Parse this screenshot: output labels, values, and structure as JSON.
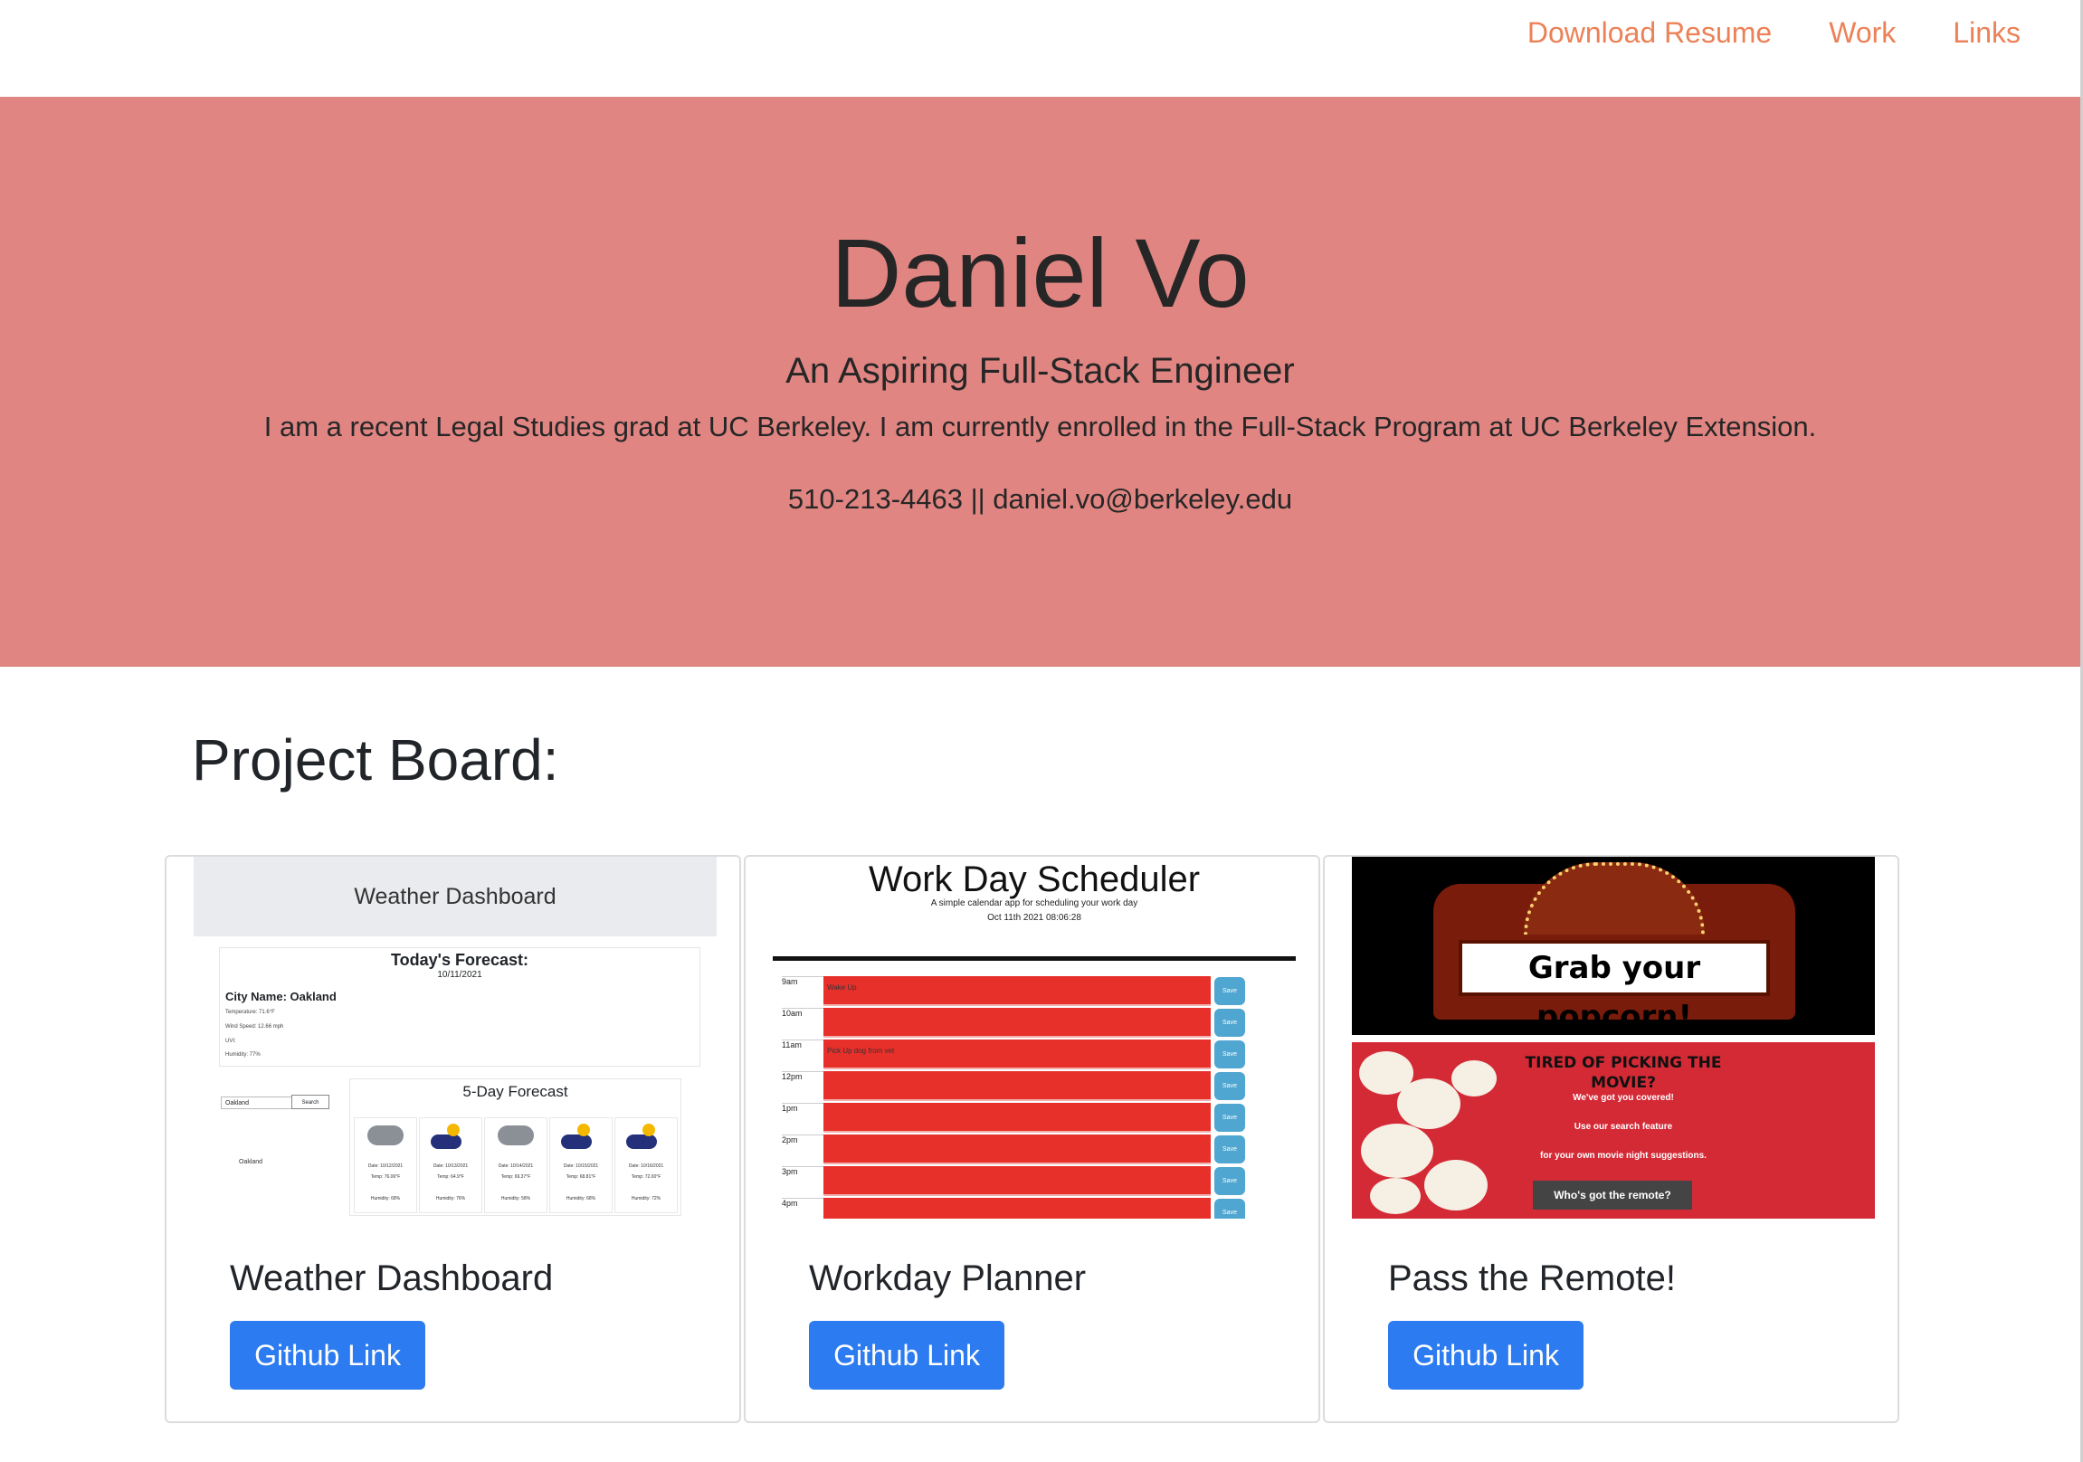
{
  "nav": {
    "links": [
      "Download Resume",
      "Work",
      "Links"
    ]
  },
  "hero": {
    "name": "Daniel Vo",
    "subtitle": "An Aspiring Full-Stack Engineer",
    "bio": "I am a recent Legal Studies grad at UC Berkeley. I am currently enrolled in the Full-Stack Program at UC Berkeley Extension.",
    "contact": "510-213-4463 || daniel.vo@berkeley.edu"
  },
  "board": {
    "title": "Project Board:"
  },
  "projects": [
    {
      "title": "Weather Dashboard",
      "button": "Github Link",
      "screenshot": {
        "header": "Weather Dashboard",
        "today_title": "Today's Forecast:",
        "today_date": "10/11/2021",
        "city": "City Name: Oakland",
        "temperature": "Temperature: 71.6°F",
        "wind": "Wind Speed: 12.66 mph",
        "uvi": "UVI:",
        "humidity": "Humidity: 77%",
        "search_value": "Oakland",
        "search_button": "Search",
        "history_item": "Oakland",
        "five_day_title": "5-Day Forecast",
        "days": [
          {
            "date": "Date: 10/12/2021",
            "temp": "Temp: 76.06°F",
            "humidity": "Humidity: 68%",
            "icon": "cloud-icon"
          },
          {
            "date": "Date: 10/13/2021",
            "temp": "Temp: 64.9°F",
            "humidity": "Humidity: 76%",
            "icon": "rain-sun-icon"
          },
          {
            "date": "Date: 10/14/2021",
            "temp": "Temp: 69.37°F",
            "humidity": "Humidity: 58%",
            "icon": "cloud-icon"
          },
          {
            "date": "Date: 10/15/2021",
            "temp": "Temp: 68.81°F",
            "humidity": "Humidity: 68%",
            "icon": "rain-sun-icon"
          },
          {
            "date": "Date: 10/16/2021",
            "temp": "Temp: 72.00°F",
            "humidity": "Humidity: 72%",
            "icon": "rain-sun-icon"
          }
        ]
      }
    },
    {
      "title": "Workday Planner",
      "button": "Github Link",
      "screenshot": {
        "title": "Work Day Scheduler",
        "subtitle": "A simple calendar app for scheduling your work day",
        "date": "Oct 11th 2021 08:06:28",
        "save_label": "Save",
        "rows": [
          {
            "hour": "9am",
            "text": "Wake Up"
          },
          {
            "hour": "10am",
            "text": ""
          },
          {
            "hour": "11am",
            "text": "Pick Up dog from vet"
          },
          {
            "hour": "12pm",
            "text": ""
          },
          {
            "hour": "1pm",
            "text": ""
          },
          {
            "hour": "2pm",
            "text": ""
          },
          {
            "hour": "3pm",
            "text": ""
          },
          {
            "hour": "4pm",
            "text": ""
          }
        ]
      }
    },
    {
      "title": "Pass the Remote!",
      "button": "Github Link",
      "screenshot": {
        "marquee": "Grab your popcorn!",
        "question": "TIRED OF PICKING THE MOVIE?",
        "line1": "We've got you covered!",
        "line2": "Use our search feature",
        "line3": "for your own movie night suggestions.",
        "cta": "Who's got the remote?"
      }
    }
  ],
  "colors": {
    "hero_bg": "#e08582",
    "nav_link": "#ec8157",
    "button_bg": "#2d7bf0"
  }
}
